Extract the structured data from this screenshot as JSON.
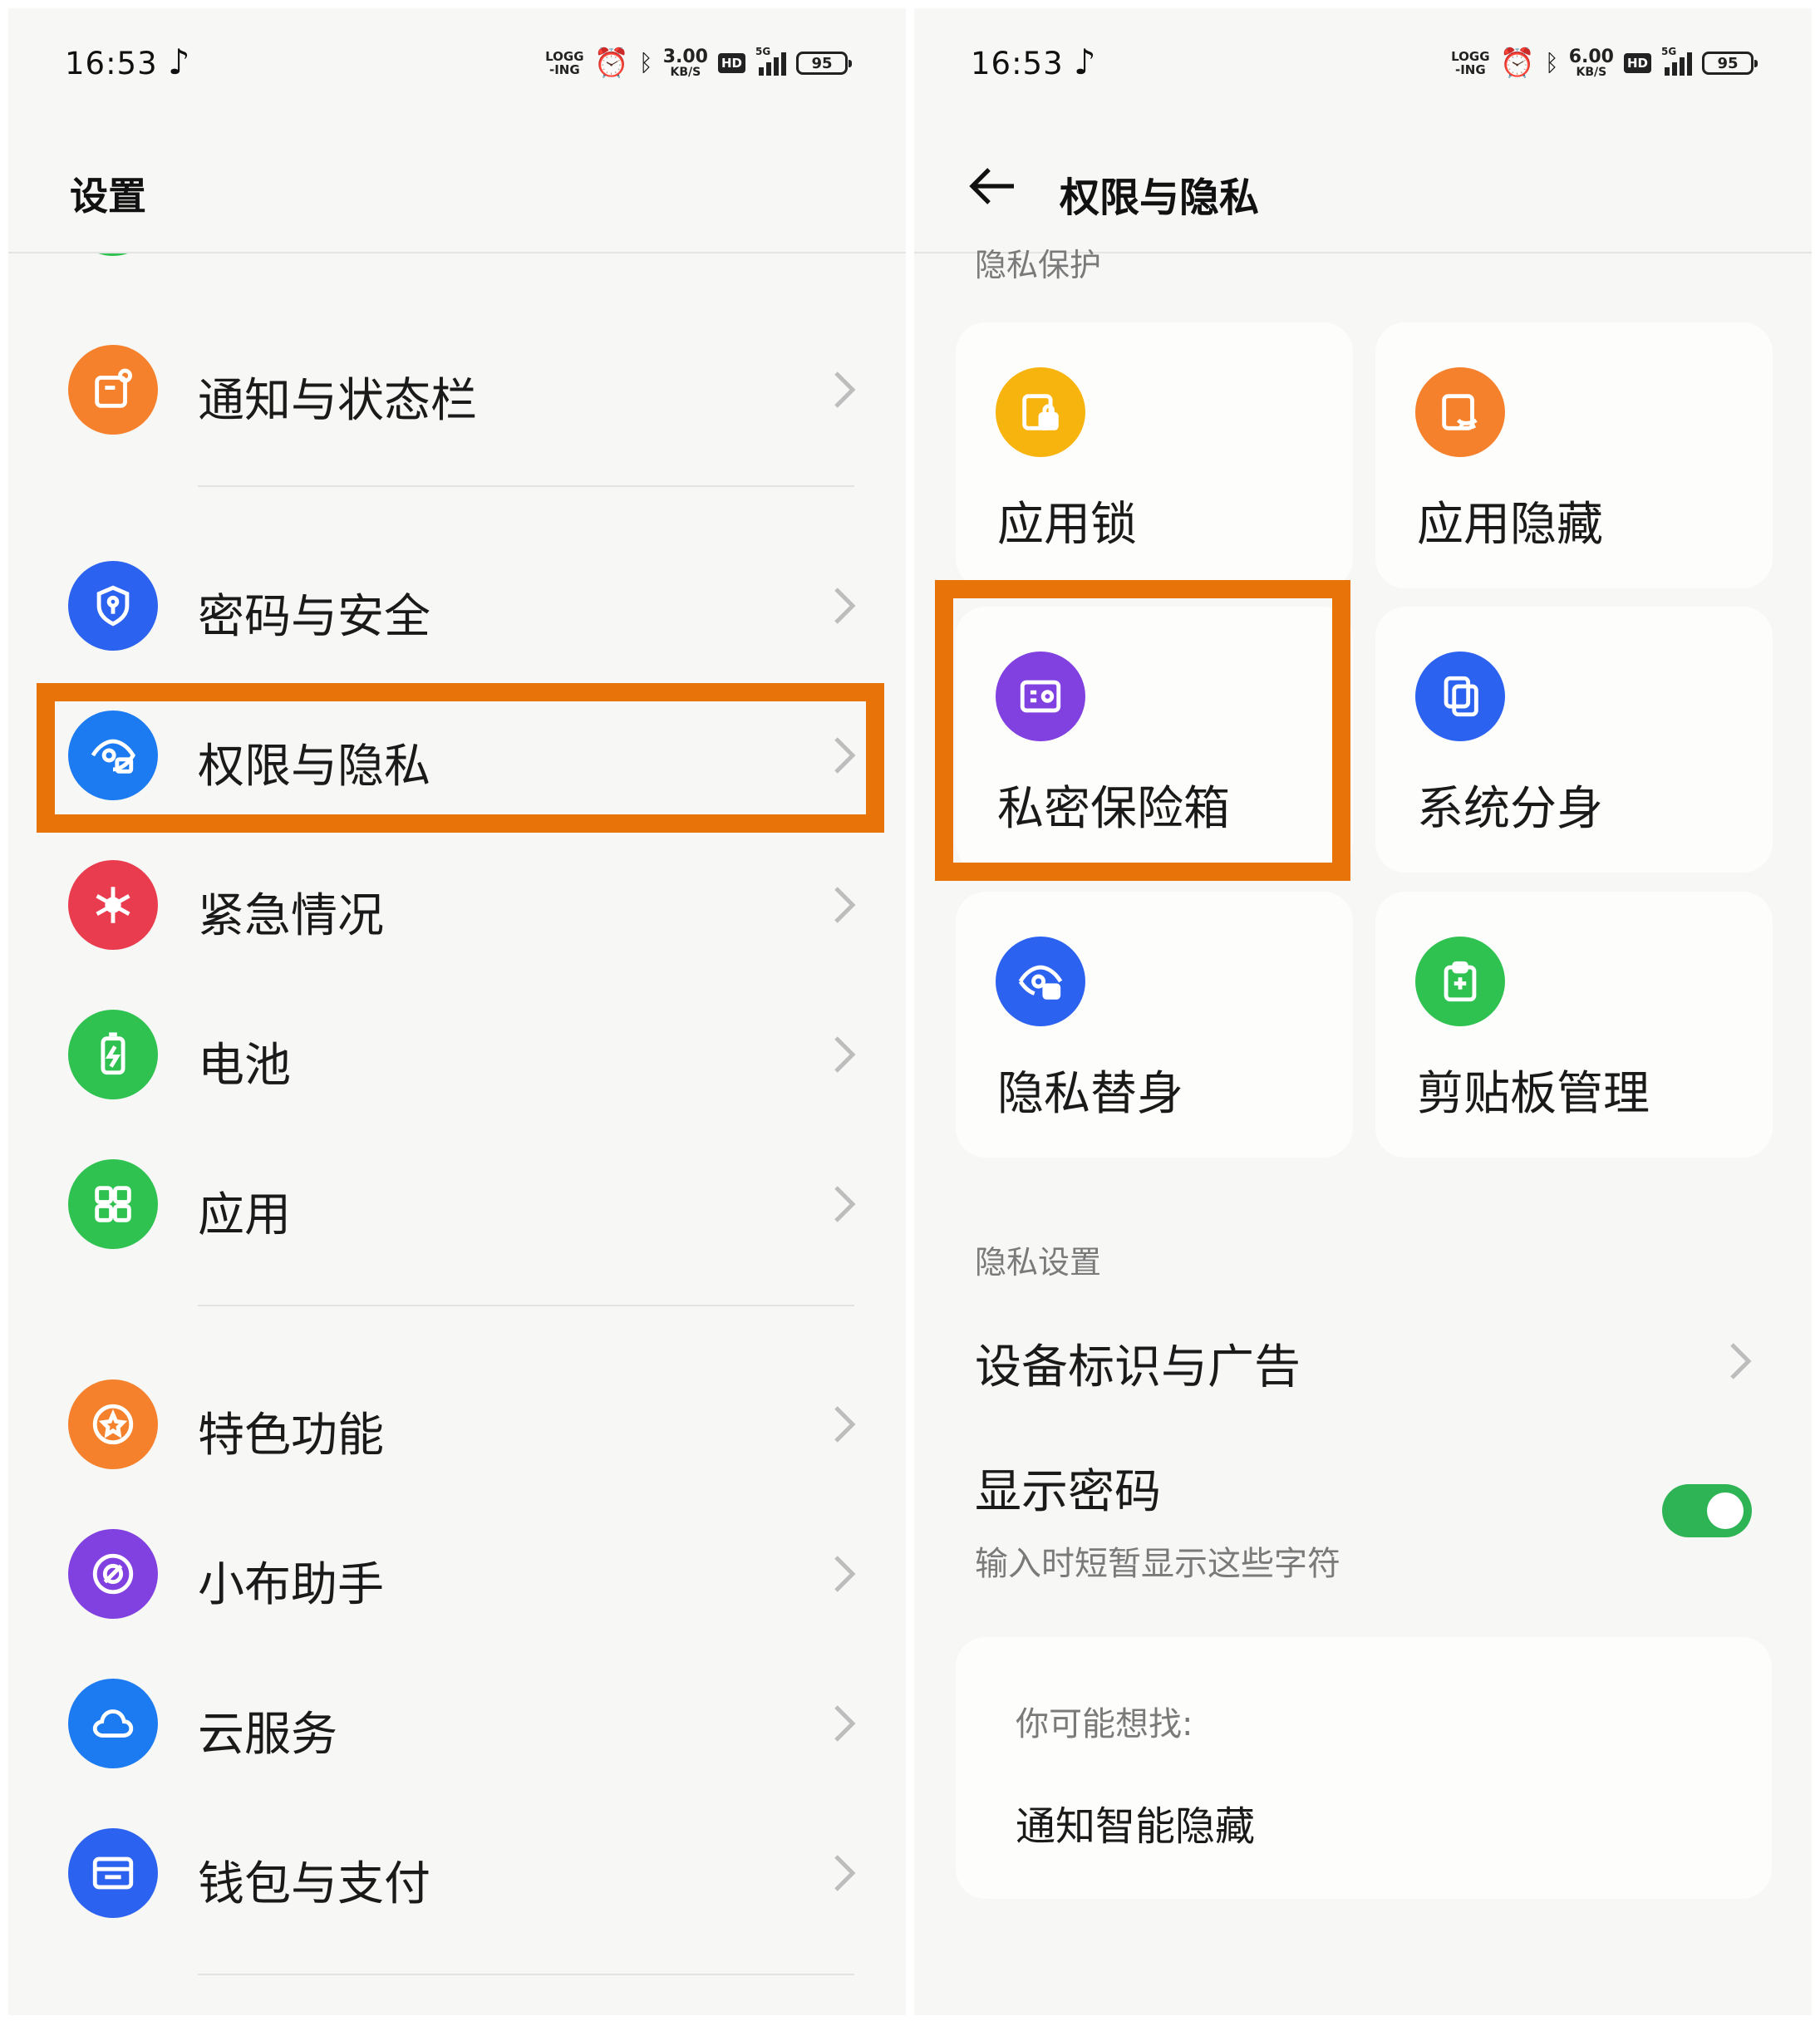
{
  "status_bar": {
    "left": {
      "time": "16:53",
      "logging": "LOGG\n-ING",
      "speed_value": "3.00",
      "speed_unit": "KB/S",
      "hd": "HD",
      "network": "5G",
      "battery": "95"
    },
    "right": {
      "time": "16:53",
      "logging": "LOGG\n-ING",
      "speed_value": "6.00",
      "speed_unit": "KB/S",
      "hd": "HD",
      "network": "5G",
      "battery": "95"
    }
  },
  "left_screen": {
    "title": "设置",
    "items": [
      {
        "label": "通知与状态栏",
        "icon": "notification-icon",
        "color": "#f5812d"
      },
      {
        "label": "密码与安全",
        "icon": "shield-key-icon",
        "color": "#2c62f0"
      },
      {
        "label": "权限与隐私",
        "icon": "privacy-eye-icon",
        "color": "#1d7bf2",
        "highlighted": true
      },
      {
        "label": "紧急情况",
        "icon": "emergency-icon",
        "color": "#ea3c4f"
      },
      {
        "label": "电池",
        "icon": "battery-icon",
        "color": "#2fc251"
      },
      {
        "label": "应用",
        "icon": "apps-grid-icon",
        "color": "#2fc251"
      },
      {
        "label": "特色功能",
        "icon": "star-circle-icon",
        "color": "#f5812d"
      },
      {
        "label": "小布助手",
        "icon": "assistant-icon",
        "color": "#8140e0"
      },
      {
        "label": "云服务",
        "icon": "cloud-icon",
        "color": "#1d7bf2"
      },
      {
        "label": "钱包与支付",
        "icon": "wallet-icon",
        "color": "#2c62f0"
      }
    ]
  },
  "right_screen": {
    "title": "权限与隐私",
    "privacy_protection": {
      "heading": "隐私保护",
      "tiles": [
        {
          "label": "应用锁",
          "icon": "app-lock-icon",
          "color": "#f8b40e"
        },
        {
          "label": "应用隐藏",
          "icon": "app-hide-icon",
          "color": "#f5812d"
        },
        {
          "label": "私密保险箱",
          "icon": "safe-box-icon",
          "color": "#8140e0",
          "highlighted": true
        },
        {
          "label": "系统分身",
          "icon": "clone-icon",
          "color": "#2c62f0"
        },
        {
          "label": "隐私替身",
          "icon": "privacy-stand-in-icon",
          "color": "#2c62f0"
        },
        {
          "label": "剪贴板管理",
          "icon": "clipboard-icon",
          "color": "#2fc251"
        }
      ]
    },
    "privacy_settings": {
      "heading": "隐私设置",
      "device_id": {
        "title": "设备标识与广告"
      },
      "show_password": {
        "title": "显示密码",
        "subtitle": "输入时短暂显示这些字符",
        "enabled": true
      }
    },
    "suggestions": {
      "heading": "你可能想找:",
      "item": "通知智能隐藏"
    }
  },
  "colors": {
    "highlight": "#e87308",
    "toggle_on": "#2fb455"
  }
}
